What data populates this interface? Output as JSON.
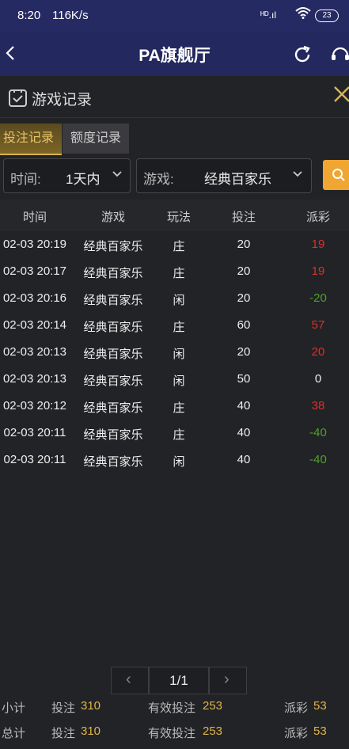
{
  "status_bar": {
    "time": "8:20",
    "speed": "116K/s",
    "signal": "ᴴᴰ.ıl",
    "battery": "23"
  },
  "nav": {
    "title": "PA旗舰厅"
  },
  "panel": {
    "title": "游戏记录"
  },
  "tabs": [
    {
      "label": "投注记录",
      "active": true
    },
    {
      "label": "额度记录",
      "active": false
    }
  ],
  "filters": {
    "time_label": "时间:",
    "time_value": "1天内",
    "game_label": "游戏:",
    "game_value": "经典百家乐"
  },
  "table": {
    "headers": [
      "时间",
      "游戏",
      "玩法",
      "投注",
      "派彩"
    ],
    "rows": [
      {
        "time": "02-03 20:19",
        "game": "经典百家乐",
        "play": "庄",
        "bet": "20",
        "payout": "19"
      },
      {
        "time": "02-03 20:17",
        "game": "经典百家乐",
        "play": "庄",
        "bet": "20",
        "payout": "19"
      },
      {
        "time": "02-03 20:16",
        "game": "经典百家乐",
        "play": "闲",
        "bet": "20",
        "payout": "-20"
      },
      {
        "time": "02-03 20:14",
        "game": "经典百家乐",
        "play": "庄",
        "bet": "60",
        "payout": "57"
      },
      {
        "time": "02-03 20:13",
        "game": "经典百家乐",
        "play": "闲",
        "bet": "20",
        "payout": "20"
      },
      {
        "time": "02-03 20:13",
        "game": "经典百家乐",
        "play": "闲",
        "bet": "50",
        "payout": "0"
      },
      {
        "time": "02-03 20:12",
        "game": "经典百家乐",
        "play": "庄",
        "bet": "40",
        "payout": "38"
      },
      {
        "time": "02-03 20:11",
        "game": "经典百家乐",
        "play": "庄",
        "bet": "40",
        "payout": "-40"
      },
      {
        "time": "02-03 20:11",
        "game": "经典百家乐",
        "play": "闲",
        "bet": "40",
        "payout": "-40"
      }
    ]
  },
  "pagination": {
    "label": "1/1",
    "prev": "‹",
    "next": "›"
  },
  "subtotal": {
    "label": "小计",
    "bet_label": "投注",
    "bet": "310",
    "valid_label": "有效投注",
    "valid": "253",
    "payout_label": "派彩",
    "payout": "53"
  },
  "total": {
    "label": "总计",
    "bet_label": "投注",
    "bet": "310",
    "valid_label": "有效投注",
    "valid": "253",
    "payout_label": "派彩",
    "payout": "53"
  },
  "colors": {
    "accent": "#e0b44a",
    "positive": "#d9312a",
    "negative": "#4fa02c",
    "nav_bg": "#23285e",
    "search_bg": "#f0a632"
  }
}
